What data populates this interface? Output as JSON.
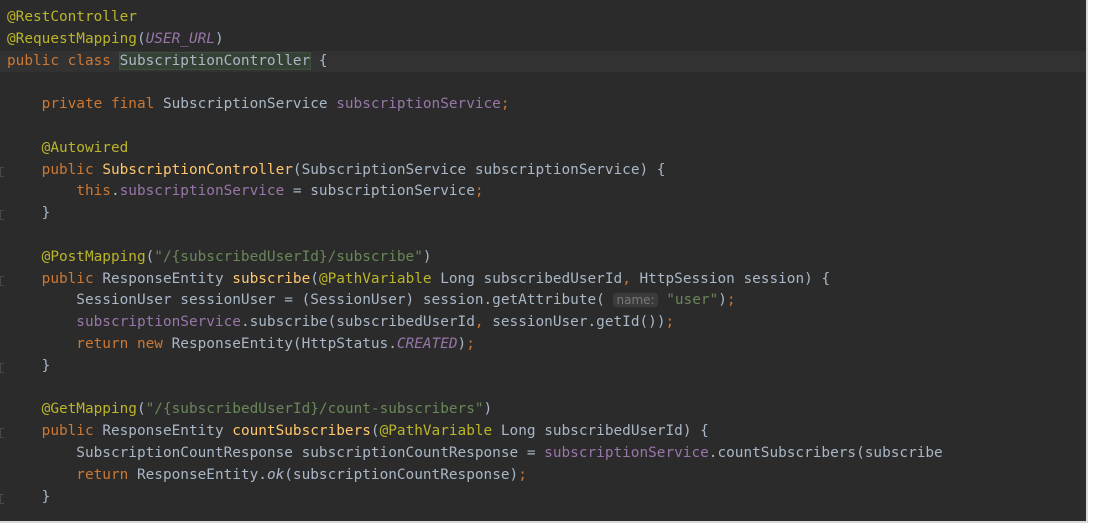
{
  "editor": {
    "colors": {
      "background": "#2b2b2b",
      "annotation": "#bbb529",
      "keyword": "#cc7832",
      "field": "#9876aa",
      "string": "#6a8759",
      "method": "#ffc66d",
      "text": "#a9b7c6"
    },
    "lines": [
      {
        "tokens": [
          {
            "t": "@RestController",
            "c": "annot"
          }
        ]
      },
      {
        "tokens": [
          {
            "t": "@RequestMapping",
            "c": "annot"
          },
          {
            "t": "(",
            "c": "plain"
          },
          {
            "t": "USER_URL",
            "c": "const"
          },
          {
            "t": ")",
            "c": "plain"
          }
        ]
      },
      {
        "highlight": true,
        "tokens": [
          {
            "t": "public class ",
            "c": "kw"
          },
          {
            "t": "SubscriptionController",
            "c": "class-sel"
          },
          {
            "t": " {",
            "c": "plain"
          }
        ]
      },
      {
        "tokens": []
      },
      {
        "tokens": [
          {
            "t": "    private final ",
            "c": "kw"
          },
          {
            "t": "SubscriptionService ",
            "c": "plain"
          },
          {
            "t": "subscriptionService",
            "c": "field"
          },
          {
            "t": ";",
            "c": "kw"
          }
        ]
      },
      {
        "tokens": []
      },
      {
        "tokens": [
          {
            "t": "    @Autowired",
            "c": "annot"
          }
        ]
      },
      {
        "tokens": [
          {
            "t": "    public ",
            "c": "kw"
          },
          {
            "t": "SubscriptionController",
            "c": "method"
          },
          {
            "t": "(SubscriptionService subscriptionService) {",
            "c": "plain"
          }
        ]
      },
      {
        "tokens": [
          {
            "t": "        this",
            "c": "kw"
          },
          {
            "t": ".",
            "c": "plain"
          },
          {
            "t": "subscriptionService",
            "c": "field"
          },
          {
            "t": " = subscriptionService",
            "c": "plain"
          },
          {
            "t": ";",
            "c": "kw"
          }
        ]
      },
      {
        "tokens": [
          {
            "t": "    }",
            "c": "plain"
          }
        ]
      },
      {
        "tokens": []
      },
      {
        "tokens": [
          {
            "t": "    @PostMapping",
            "c": "annot"
          },
          {
            "t": "(",
            "c": "plain"
          },
          {
            "t": "\"/{subscribedUserId}/subscribe\"",
            "c": "str"
          },
          {
            "t": ")",
            "c": "plain"
          }
        ]
      },
      {
        "tokens": [
          {
            "t": "    public ",
            "c": "kw"
          },
          {
            "t": "ResponseEntity ",
            "c": "plain"
          },
          {
            "t": "subscribe",
            "c": "method"
          },
          {
            "t": "(",
            "c": "plain"
          },
          {
            "t": "@PathVariable ",
            "c": "annot"
          },
          {
            "t": "Long subscribedUserId",
            "c": "plain"
          },
          {
            "t": ", ",
            "c": "kw"
          },
          {
            "t": "HttpSession session) {",
            "c": "plain"
          }
        ]
      },
      {
        "tokens": [
          {
            "t": "        SessionUser sessionUser = (SessionUser) session.getAttribute( ",
            "c": "plain"
          },
          {
            "t": "name:",
            "c": "hint"
          },
          {
            "t": " ",
            "c": "plain"
          },
          {
            "t": "\"user\"",
            "c": "str"
          },
          {
            "t": ")",
            "c": "plain"
          },
          {
            "t": ";",
            "c": "kw"
          }
        ]
      },
      {
        "tokens": [
          {
            "t": "        subscriptionService",
            "c": "field"
          },
          {
            "t": ".subscribe(subscribedUserId",
            "c": "plain"
          },
          {
            "t": ", ",
            "c": "kw"
          },
          {
            "t": "sessionUser.getId())",
            "c": "plain"
          },
          {
            "t": ";",
            "c": "kw"
          }
        ]
      },
      {
        "tokens": [
          {
            "t": "        return new ",
            "c": "kw"
          },
          {
            "t": "ResponseEntity(HttpStatus.",
            "c": "plain"
          },
          {
            "t": "CREATED",
            "c": "const"
          },
          {
            "t": ")",
            "c": "plain"
          },
          {
            "t": ";",
            "c": "kw"
          }
        ]
      },
      {
        "tokens": [
          {
            "t": "    }",
            "c": "plain"
          }
        ]
      },
      {
        "tokens": []
      },
      {
        "tokens": [
          {
            "t": "    @GetMapping",
            "c": "annot"
          },
          {
            "t": "(",
            "c": "plain"
          },
          {
            "t": "\"/{subscribedUserId}/count-subscribers\"",
            "c": "str"
          },
          {
            "t": ")",
            "c": "plain"
          }
        ]
      },
      {
        "tokens": [
          {
            "t": "    public ",
            "c": "kw"
          },
          {
            "t": "ResponseEntity ",
            "c": "plain"
          },
          {
            "t": "countSubscribers",
            "c": "method"
          },
          {
            "t": "(",
            "c": "plain"
          },
          {
            "t": "@PathVariable ",
            "c": "annot"
          },
          {
            "t": "Long subscribedUserId) {",
            "c": "plain"
          }
        ]
      },
      {
        "tokens": [
          {
            "t": "        SubscriptionCountResponse subscriptionCountResponse = ",
            "c": "plain"
          },
          {
            "t": "subscriptionService",
            "c": "field"
          },
          {
            "t": ".countSubscribers(subscribe",
            "c": "plain"
          }
        ]
      },
      {
        "tokens": [
          {
            "t": "        return ",
            "c": "kw"
          },
          {
            "t": "ResponseEntity.",
            "c": "plain"
          },
          {
            "t": "ok",
            "c": "ital"
          },
          {
            "t": "(subscriptionCountResponse)",
            "c": "plain"
          },
          {
            "t": ";",
            "c": "kw"
          }
        ]
      },
      {
        "tokens": [
          {
            "t": "    }",
            "c": "plain"
          }
        ]
      }
    ]
  }
}
